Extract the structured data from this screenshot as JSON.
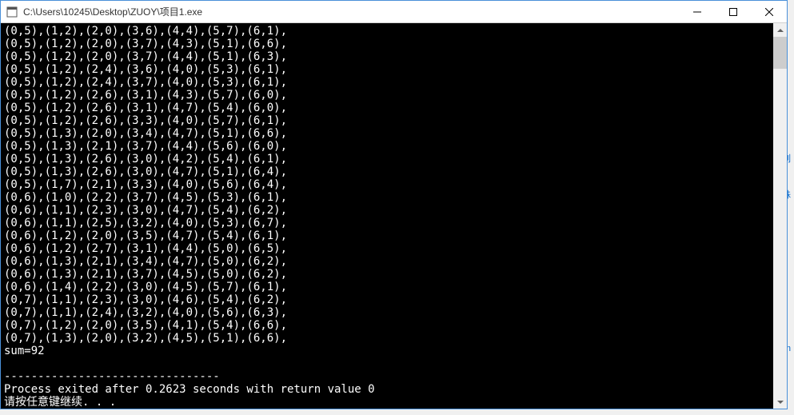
{
  "window": {
    "title": "C:\\Users\\10245\\Desktop\\ZUOY\\项目1.exe"
  },
  "console": {
    "lines": [
      "(0,5),(1,2),(2,0),(3,6),(4,4),(5,7),(6,1),",
      "(0,5),(1,2),(2,0),(3,7),(4,3),(5,1),(6,6),",
      "(0,5),(1,2),(2,0),(3,7),(4,4),(5,1),(6,3),",
      "(0,5),(1,2),(2,4),(3,6),(4,0),(5,3),(6,1),",
      "(0,5),(1,2),(2,4),(3,7),(4,0),(5,3),(6,1),",
      "(0,5),(1,2),(2,6),(3,1),(4,3),(5,7),(6,0),",
      "(0,5),(1,2),(2,6),(3,1),(4,7),(5,4),(6,0),",
      "(0,5),(1,2),(2,6),(3,3),(4,0),(5,7),(6,1),",
      "(0,5),(1,3),(2,0),(3,4),(4,7),(5,1),(6,6),",
      "(0,5),(1,3),(2,1),(3,7),(4,4),(5,6),(6,0),",
      "(0,5),(1,3),(2,6),(3,0),(4,2),(5,4),(6,1),",
      "(0,5),(1,3),(2,6),(3,0),(4,7),(5,1),(6,4),",
      "(0,5),(1,7),(2,1),(3,3),(4,0),(5,6),(6,4),",
      "(0,6),(1,0),(2,2),(3,7),(4,5),(5,3),(6,1),",
      "(0,6),(1,1),(2,3),(3,0),(4,7),(5,4),(6,2),",
      "(0,6),(1,1),(2,5),(3,2),(4,0),(5,3),(6,7),",
      "(0,6),(1,2),(2,0),(3,5),(4,7),(5,4),(6,1),",
      "(0,6),(1,2),(2,7),(3,1),(4,4),(5,0),(6,5),",
      "(0,6),(1,3),(2,1),(3,4),(4,7),(5,0),(6,2),",
      "(0,6),(1,3),(2,1),(3,7),(4,5),(5,0),(6,2),",
      "(0,6),(1,4),(2,2),(3,0),(4,5),(5,7),(6,1),",
      "(0,7),(1,1),(2,3),(3,0),(4,6),(5,4),(6,2),",
      "(0,7),(1,1),(2,4),(3,2),(4,0),(5,6),(6,3),",
      "(0,7),(1,2),(2,0),(3,5),(4,1),(5,4),(6,6),",
      "(0,7),(1,3),(2,0),(3,2),(4,5),(5,1),(6,6),",
      "sum=92",
      "",
      "--------------------------------",
      "Process exited after 0.2623 seconds with return value 0",
      "请按任意键继续. . ."
    ]
  },
  "background": {
    "snippet1": "列",
    "snippet2": "殊",
    "snippet3": "m"
  }
}
